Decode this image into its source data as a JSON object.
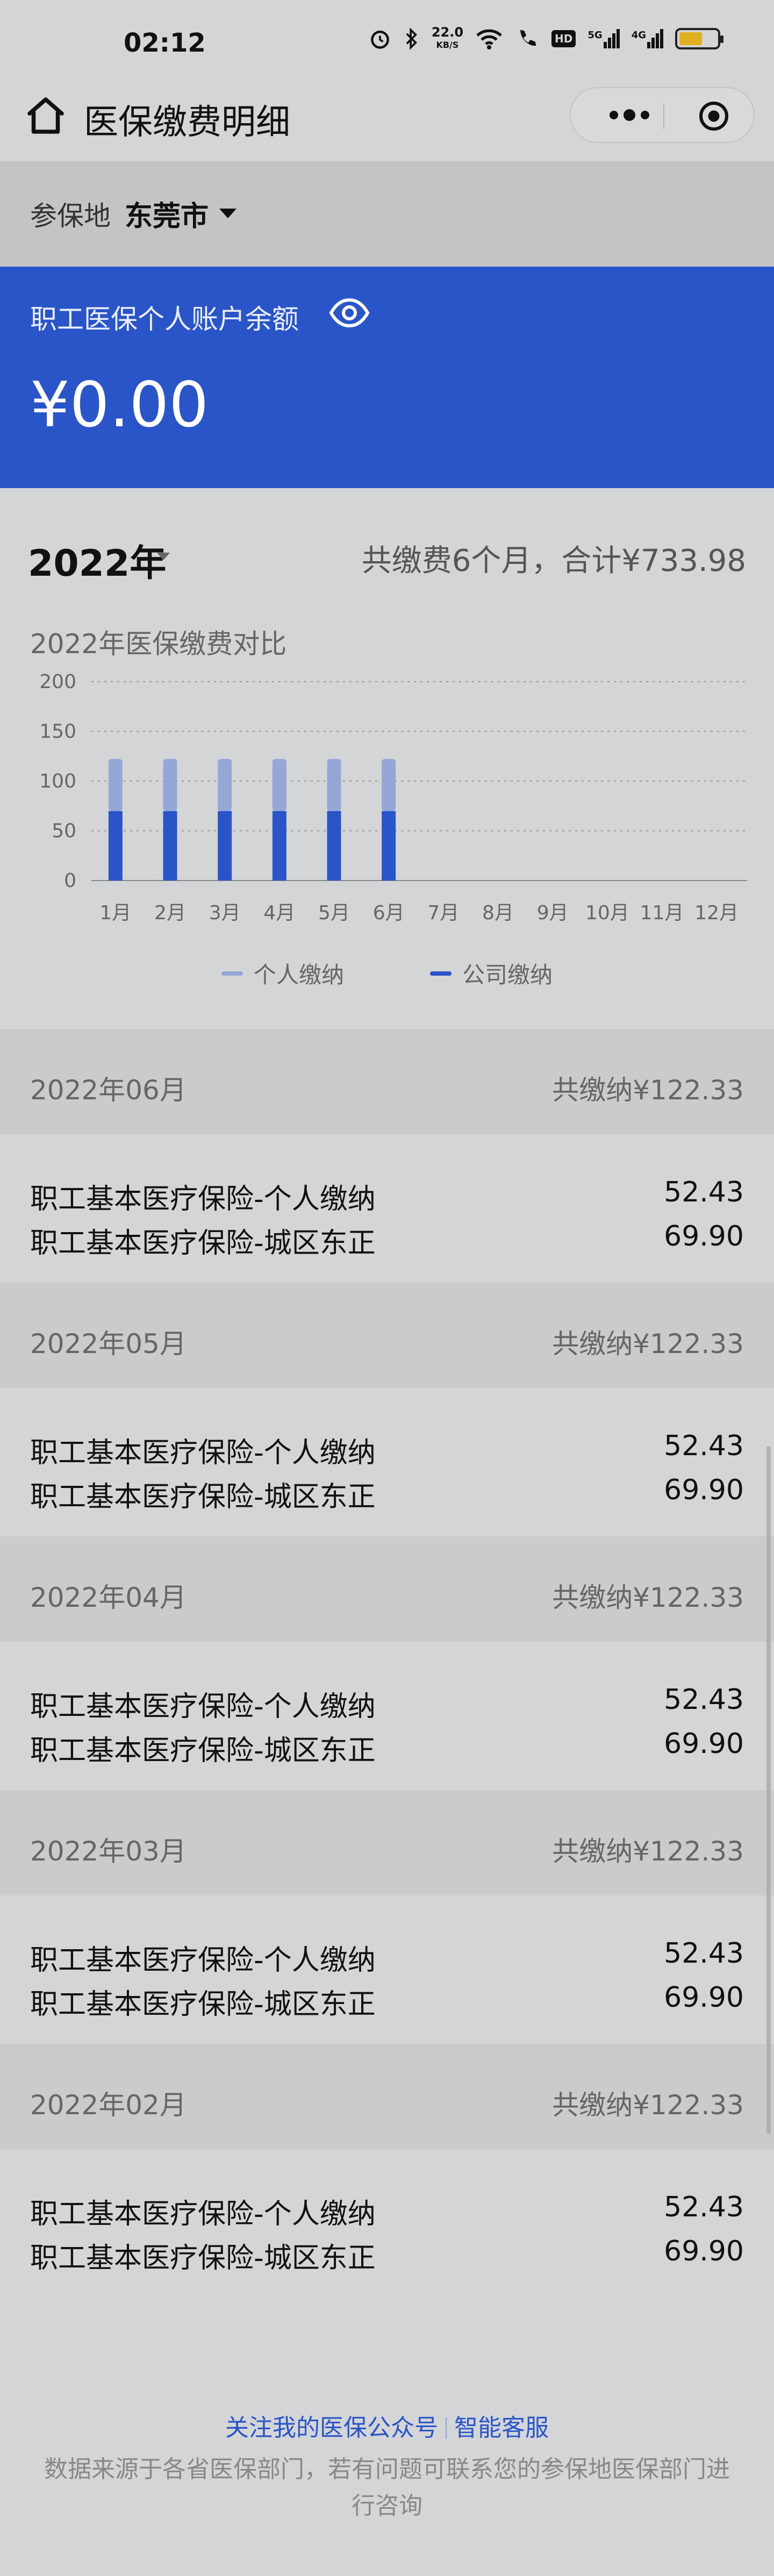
{
  "status_bar": {
    "time": "02:12",
    "net_speed_value": "22.0",
    "net_speed_unit": "KB/S",
    "hd_badge": "HD",
    "signal1_label": "5G",
    "signal2_label": "4G",
    "battery_level": 0.64
  },
  "navbar": {
    "title": "医保缴费明细"
  },
  "region": {
    "label": "参保地",
    "value": "东莞市"
  },
  "balance": {
    "label": "职工医保个人账户余额",
    "amount": "¥0.00"
  },
  "year_summary": {
    "year": "2022年",
    "summary": "共缴费6个月，合计¥733.98"
  },
  "chart_data": {
    "type": "bar",
    "title": "2022年医保缴费对比",
    "categories": [
      "1月",
      "2月",
      "3月",
      "4月",
      "5月",
      "6月",
      "7月",
      "8月",
      "9月",
      "10月",
      "11月",
      "12月"
    ],
    "series": [
      {
        "name": "公司缴纳",
        "values": [
          69.9,
          69.9,
          69.9,
          69.9,
          69.9,
          69.9,
          0,
          0,
          0,
          0,
          0,
          0
        ],
        "color": "#2a55c8"
      },
      {
        "name": "个人缴纳",
        "values": [
          52.43,
          52.43,
          52.43,
          52.43,
          52.43,
          52.43,
          0,
          0,
          0,
          0,
          0,
          0
        ],
        "color": "#95a7d6"
      }
    ],
    "stacked": true,
    "yticks": [
      0,
      50,
      100,
      150,
      200
    ],
    "ylim": [
      0,
      200
    ],
    "grid": true,
    "legend_position": "bottom"
  },
  "records": [
    {
      "month": "2022年06月",
      "total": "共缴纳¥122.33",
      "items": [
        {
          "name": "职工基本医疗保险-个人缴纳",
          "amount": "52.43"
        },
        {
          "name": "职工基本医疗保险-城区东正",
          "amount": "69.90"
        }
      ]
    },
    {
      "month": "2022年05月",
      "total": "共缴纳¥122.33",
      "items": [
        {
          "name": "职工基本医疗保险-个人缴纳",
          "amount": "52.43"
        },
        {
          "name": "职工基本医疗保险-城区东正",
          "amount": "69.90"
        }
      ]
    },
    {
      "month": "2022年04月",
      "total": "共缴纳¥122.33",
      "items": [
        {
          "name": "职工基本医疗保险-个人缴纳",
          "amount": "52.43"
        },
        {
          "name": "职工基本医疗保险-城区东正",
          "amount": "69.90"
        }
      ]
    },
    {
      "month": "2022年03月",
      "total": "共缴纳¥122.33",
      "items": [
        {
          "name": "职工基本医疗保险-个人缴纳",
          "amount": "52.43"
        },
        {
          "name": "职工基本医疗保险-城区东正",
          "amount": "69.90"
        }
      ]
    },
    {
      "month": "2022年02月",
      "total": "共缴纳¥122.33",
      "items": [
        {
          "name": "职工基本医疗保险-个人缴纳",
          "amount": "52.43"
        },
        {
          "name": "职工基本医疗保险-城区东正",
          "amount": "69.90"
        }
      ]
    }
  ],
  "footer": {
    "link1": "关注我的医保公众号",
    "link2": "智能客服",
    "note": "数据来源于各省医保部门，若有问题可联系您的参保地医保部门进行咨询"
  }
}
